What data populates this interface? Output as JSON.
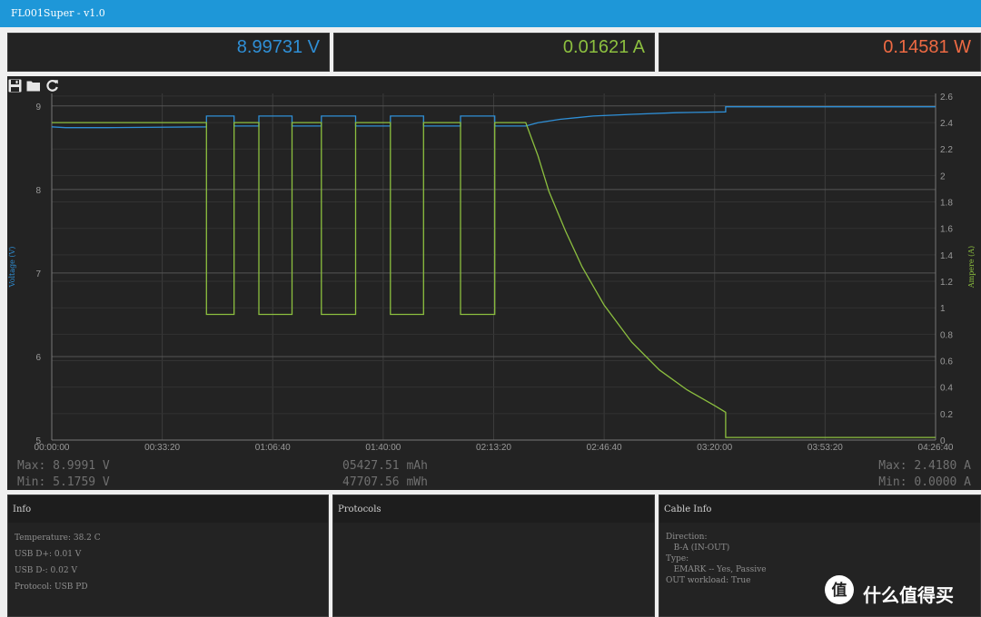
{
  "window": {
    "title": "FL001Super - v1.0"
  },
  "meters": {
    "voltage": "8.99731 V",
    "current": "0.01621 A",
    "power": "0.14581 W"
  },
  "toolbar": {
    "icons": [
      "save-icon",
      "folder-icon",
      "refresh-icon"
    ]
  },
  "stats": {
    "max_voltage": "Max: 8.9991 V",
    "min_voltage": "Min: 5.1759 V",
    "capacity_mah": "05427.51 mAh",
    "energy_mwh": "47707.56 mWh",
    "max_current": "Max: 2.4180 A",
    "min_current": "Min: 0.0000 A"
  },
  "colors": {
    "voltage": "#2f8fd6",
    "current": "#8cbf3f",
    "power": "#ee6a43",
    "titlebar": "#1e97d8"
  },
  "chart_data": {
    "type": "line",
    "xlabel": "",
    "ylabel": "Voltage (V)",
    "y2label": "Ampere (A)",
    "x_ticks": [
      "00:00:00",
      "00:33:20",
      "01:06:40",
      "01:40:00",
      "02:13:20",
      "02:46:40",
      "03:20:00",
      "03:53:20",
      "04:26:40"
    ],
    "x_range": [
      0,
      16000
    ],
    "ylim": [
      5,
      9.15
    ],
    "y2lim": [
      0,
      2.62
    ],
    "y_ticks": [
      5,
      6,
      7,
      8,
      9
    ],
    "y2_ticks": [
      0,
      0.2,
      0.4,
      0.6,
      0.8,
      1,
      1.2,
      1.4,
      1.6,
      1.8,
      2,
      2.2,
      2.4,
      2.6
    ],
    "grid": true,
    "series": [
      {
        "name": "Voltage (V)",
        "axis": "left",
        "points": [
          [
            0,
            8.75
          ],
          [
            250,
            8.74
          ],
          [
            1000,
            8.74
          ],
          [
            2800,
            8.75
          ],
          [
            2800,
            8.88
          ],
          [
            3300,
            8.88
          ],
          [
            3300,
            8.76
          ],
          [
            3750,
            8.76
          ],
          [
            3750,
            8.88
          ],
          [
            4350,
            8.88
          ],
          [
            4350,
            8.76
          ],
          [
            4880,
            8.76
          ],
          [
            4880,
            8.88
          ],
          [
            5500,
            8.88
          ],
          [
            5500,
            8.76
          ],
          [
            6130,
            8.76
          ],
          [
            6130,
            8.88
          ],
          [
            6730,
            8.88
          ],
          [
            6730,
            8.76
          ],
          [
            7400,
            8.76
          ],
          [
            7400,
            8.88
          ],
          [
            8020,
            8.88
          ],
          [
            8020,
            8.76
          ],
          [
            8580,
            8.76
          ],
          [
            8800,
            8.8
          ],
          [
            9200,
            8.84
          ],
          [
            9800,
            8.88
          ],
          [
            10500,
            8.9
          ],
          [
            11300,
            8.92
          ],
          [
            12200,
            8.93
          ],
          [
            12200,
            8.99
          ],
          [
            16000,
            8.99
          ]
        ]
      },
      {
        "name": "Ampere (A)",
        "axis": "right",
        "points": [
          [
            0,
            2.4
          ],
          [
            2800,
            2.4
          ],
          [
            2800,
            0.95
          ],
          [
            3300,
            0.95
          ],
          [
            3300,
            2.4
          ],
          [
            3750,
            2.4
          ],
          [
            3750,
            0.95
          ],
          [
            4350,
            0.95
          ],
          [
            4350,
            2.4
          ],
          [
            4880,
            2.4
          ],
          [
            4880,
            0.95
          ],
          [
            5500,
            0.95
          ],
          [
            5500,
            2.4
          ],
          [
            6130,
            2.4
          ],
          [
            6130,
            0.95
          ],
          [
            6730,
            0.95
          ],
          [
            6730,
            2.4
          ],
          [
            7400,
            2.4
          ],
          [
            7400,
            0.95
          ],
          [
            8020,
            0.95
          ],
          [
            8020,
            2.4
          ],
          [
            8580,
            2.4
          ],
          [
            8800,
            2.15
          ],
          [
            9000,
            1.88
          ],
          [
            9300,
            1.58
          ],
          [
            9600,
            1.31
          ],
          [
            10000,
            1.02
          ],
          [
            10500,
            0.74
          ],
          [
            11000,
            0.53
          ],
          [
            11500,
            0.38
          ],
          [
            12000,
            0.26
          ],
          [
            12200,
            0.21
          ],
          [
            12200,
            0.02
          ],
          [
            16000,
            0.02
          ]
        ]
      }
    ]
  },
  "panels": {
    "info": {
      "title": "Info",
      "lines": [
        "Temperature: 38.2 C",
        "USB D+: 0.01 V",
        "USB D-: 0.02 V",
        "Protocol: USB PD"
      ]
    },
    "protocols": {
      "title": "Protocols"
    },
    "cable_info": {
      "title": "Cable Info",
      "lines": [
        "Direction:",
        "   B-A (IN-OUT)",
        "Type:",
        "   EMARK -- Yes, Passive",
        "OUT workload: True"
      ]
    }
  },
  "watermark": {
    "text": "什么值得买"
  }
}
